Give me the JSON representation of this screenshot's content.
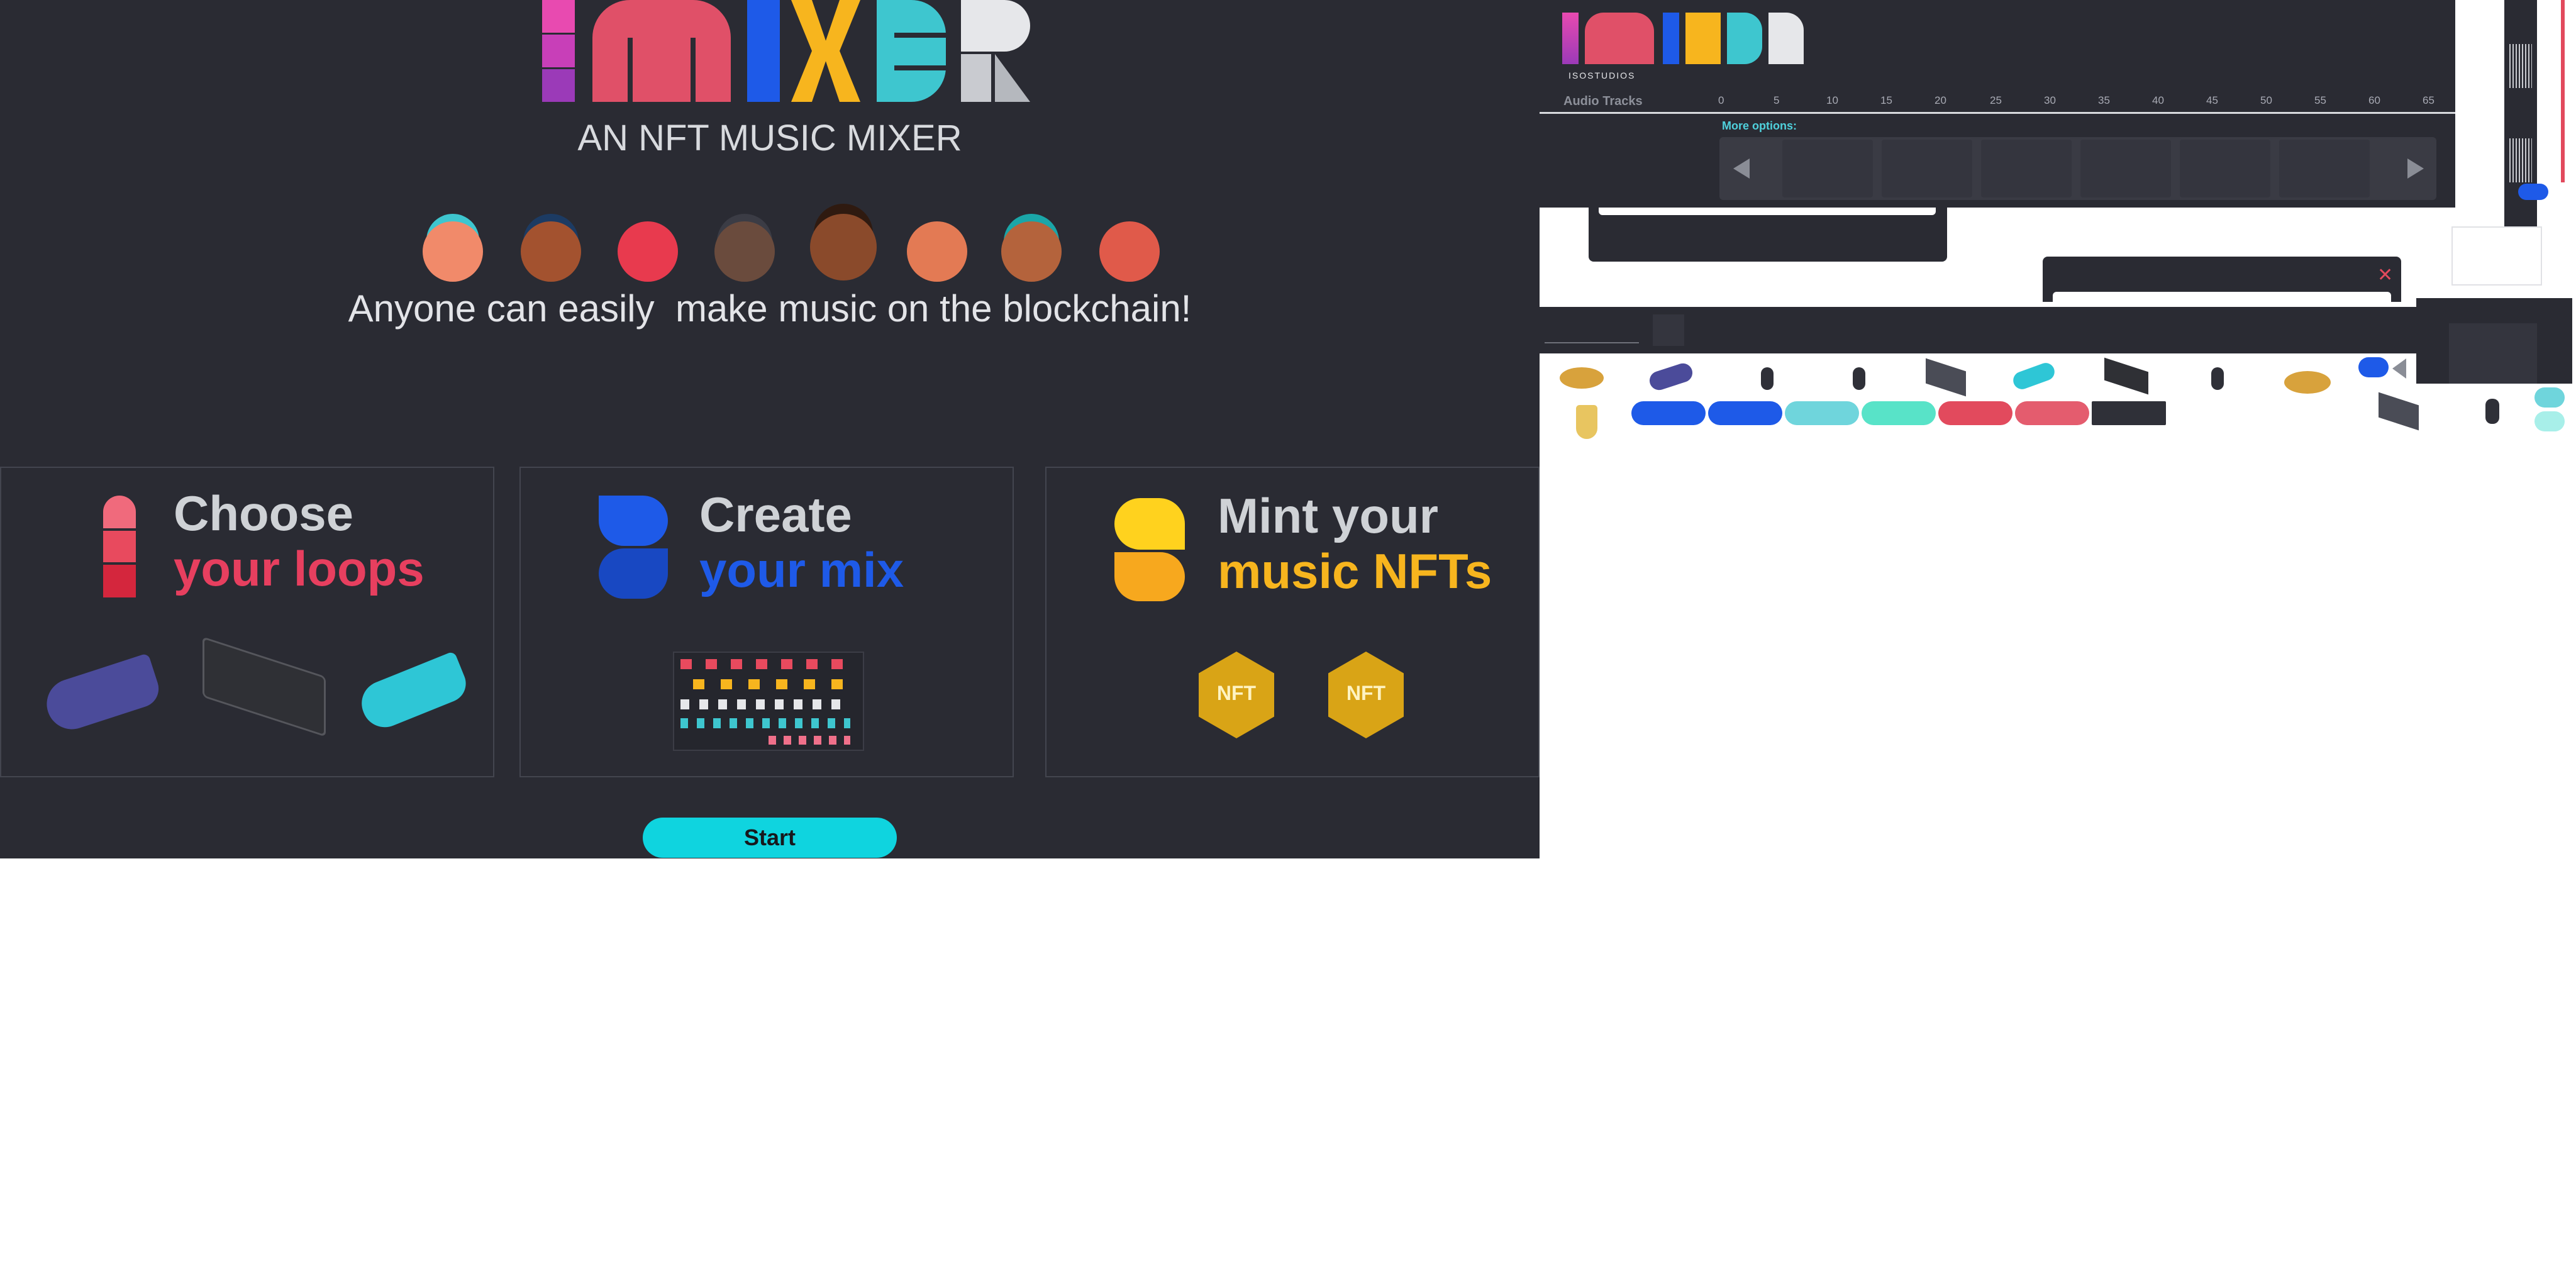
{
  "landing": {
    "logo_text": "MIXER",
    "tagline": "AN NFT MUSIC MIXER",
    "headline": "Anyone can easily  make music on the blockchain!",
    "cards": [
      {
        "line1": "Choose",
        "line2": "your loops",
        "accent": "#e73f5f"
      },
      {
        "line1": "Create",
        "line2": "your mix",
        "accent": "#1e5ae8"
      },
      {
        "line1": "Mint your",
        "line2": "music NFTs",
        "accent": "#f7b51e"
      }
    ],
    "nft_badge_text": "NFT",
    "start_label": "Start"
  },
  "editor": {
    "logo_text": "MIXER",
    "studio_label": "ISOSTUDIOS",
    "audio_tracks_label": "Audio Tracks",
    "timeline_ticks": [
      "0",
      "5",
      "10",
      "15",
      "20",
      "25",
      "30",
      "35",
      "40",
      "45",
      "50",
      "55",
      "60",
      "65"
    ],
    "more_options_label": "More options:",
    "prev_icon": "triangle-left-icon",
    "next_icon": "triangle-right-icon",
    "close_icon": "close-icon"
  },
  "colors": {
    "background_dark": "#2a2b33",
    "accent_pink": "#e73f5f",
    "accent_blue": "#1e5ae8",
    "accent_yellow": "#f7b51e",
    "accent_cyan": "#0fd4df",
    "text_light": "#d8dade"
  },
  "palette_pills": [
    "#1e5ae8",
    "#1e5ae8",
    "#6fd5dc",
    "#58e3c8",
    "#e24a5d",
    "#e45c6e",
    "#2f3038"
  ]
}
